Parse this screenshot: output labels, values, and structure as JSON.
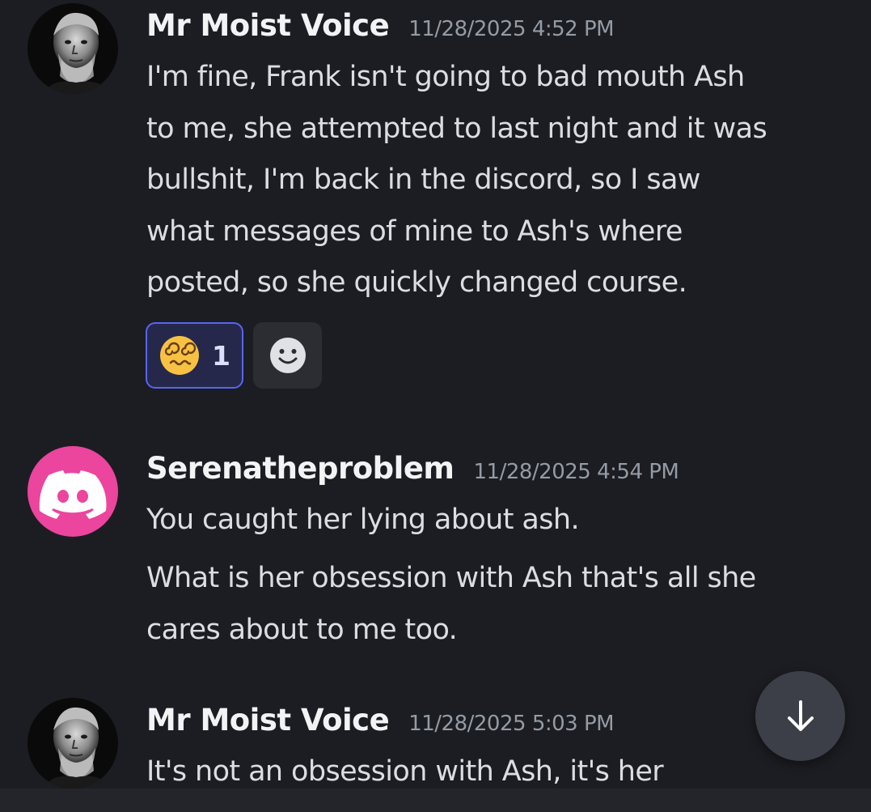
{
  "messages": [
    {
      "author": "Mr Moist Voice",
      "timestamp": "11/28/2025 4:52 PM",
      "avatar_type": "photo-grayscale-man",
      "lines": [
        "I'm fine, Frank isn't going to bad mouth Ash",
        "to me, she attempted to last night and it was",
        "bullshit, I'm back in the discord, so I saw",
        "what messages of mine to Ash's where",
        "posted, so she quickly changed course."
      ],
      "reactions": [
        {
          "emoji": "dizzy-face-emoji",
          "count": "1",
          "selected": true
        }
      ],
      "add_reaction_icon": "smiley-add-reaction-icon"
    },
    {
      "author": "Serenatheproblem",
      "timestamp": "11/28/2025 4:54 PM",
      "avatar_type": "discord-default-avatar",
      "avatar_color": "#eb459e",
      "lines": [
        "You caught her lying about ash."
      ],
      "followup_lines": [
        "What is her obsession with Ash that's all she",
        "cares about to me too."
      ]
    },
    {
      "author": "Mr Moist Voice",
      "timestamp": "11/28/2025 5:03 PM",
      "avatar_type": "photo-grayscale-man",
      "lines": [
        "It's not an obsession with Ash, it's her"
      ]
    }
  ],
  "jump_to_present": {
    "icon": "arrow-down-icon"
  },
  "colors": {
    "background": "#1c1d22",
    "username": "#f2f3f5",
    "timestamp": "#949ba4",
    "message_text": "#dbdee1",
    "reaction_active_bg": "#25284a",
    "reaction_active_border": "#5865f2"
  }
}
